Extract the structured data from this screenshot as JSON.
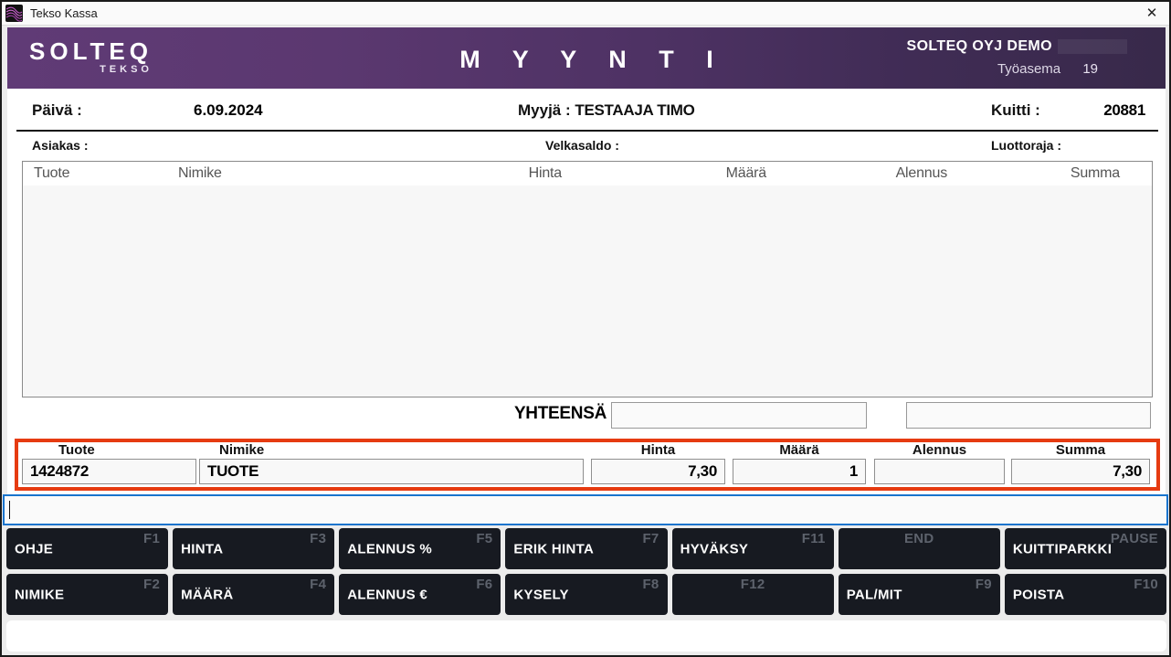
{
  "window": {
    "title": "Tekso Kassa",
    "close_glyph": "✕"
  },
  "header": {
    "logo_primary": "SOLTEQ",
    "logo_secondary": "TEKSO",
    "screen_title": "M Y Y N T I",
    "company": "SOLTEQ OYJ DEMO",
    "workstation_label": "Työasema",
    "workstation_number": "19"
  },
  "info_bar": {
    "date_label": "Päivä :",
    "date_value": "6.09.2024",
    "seller_label": "Myyjä :",
    "seller_value": "TESTAAJA TIMO",
    "receipt_label": "Kuitti :",
    "receipt_number": "20881",
    "customer_label": "Asiakas :",
    "debt_label": "Velkasaldo :",
    "credit_label": "Luottoraja :"
  },
  "sales_table": {
    "columns": [
      "Tuote",
      "Nimike",
      "Hinta",
      "Määrä",
      "Alennus",
      "Summa"
    ],
    "rows": []
  },
  "totals": {
    "label": "YHTEENSÄ",
    "total_value": "",
    "secondary_value": ""
  },
  "entry_row": {
    "fields": [
      {
        "name": "tuote",
        "label": "Tuote",
        "value": "1424872"
      },
      {
        "name": "nimike",
        "label": "Nimike",
        "value": "TUOTE"
      },
      {
        "name": "hinta",
        "label": "Hinta",
        "value": "7,30"
      },
      {
        "name": "maara",
        "label": "Määrä",
        "value": "1"
      },
      {
        "name": "alennus",
        "label": "Alennus",
        "value": ""
      },
      {
        "name": "summa",
        "label": "Summa",
        "value": "7,30"
      }
    ]
  },
  "command_input": {
    "value": ""
  },
  "function_keys": {
    "rows": [
      [
        {
          "label": "OHJE",
          "key": "F1"
        },
        {
          "label": "HINTA",
          "key": "F3"
        },
        {
          "label": "ALENNUS %",
          "key": "F5"
        },
        {
          "label": "ERIK HINTA",
          "key": "F7"
        },
        {
          "label": "HYVÄKSY",
          "key": "F11"
        },
        {
          "label": "",
          "key": "END"
        },
        {
          "label": "KUITTIPARKKI",
          "key": "PAUSE"
        }
      ],
      [
        {
          "label": "NIMIKE",
          "key": "F2"
        },
        {
          "label": "MÄÄRÄ",
          "key": "F4"
        },
        {
          "label": "ALENNUS €",
          "key": "F6"
        },
        {
          "label": "KYSELY",
          "key": "F8"
        },
        {
          "label": "",
          "key": "F12"
        },
        {
          "label": "PAL/MIT",
          "key": "F9"
        },
        {
          "label": "POISTA",
          "key": "F10"
        }
      ]
    ]
  },
  "status_bar": {
    "message": ""
  },
  "colors": {
    "header_gradient_start": "#603b76",
    "header_gradient_end": "#38294a",
    "accent_red": "#e63b11",
    "accent_blue": "#1874cd",
    "button_bg": "#171a21"
  }
}
